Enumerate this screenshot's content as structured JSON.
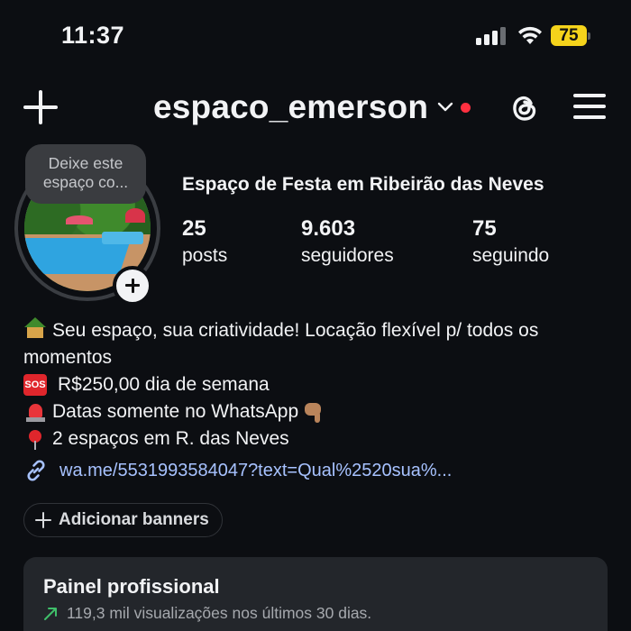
{
  "status_bar": {
    "time": "11:37",
    "battery": "75",
    "battery_color": "#f5d31b"
  },
  "header": {
    "username": "espaco_emerson",
    "icons": [
      "plus-icon",
      "chevron-down-icon",
      "threads-icon",
      "hamburger-menu-icon"
    ],
    "notification_dot_color": "#ff3040"
  },
  "profile": {
    "note": "Deixe este espaço co...",
    "full_name": "Espaço de Festa em Ribeirão das Neves",
    "stats": [
      {
        "value": "25",
        "label": "posts"
      },
      {
        "value": "9.603",
        "label": "seguidores"
      },
      {
        "value": "75",
        "label": "seguindo"
      }
    ]
  },
  "bio": {
    "lines": [
      {
        "emoji": "house-with-garden-emoji",
        "text": "Seu espaço, sua criatividade! Locação flexível p/ todos os momentos"
      },
      {
        "emoji": "sos-emoji",
        "text": "R$250,00 dia de semana"
      },
      {
        "emoji": "police-light-emoji",
        "text": "Datas somente no WhatsApp",
        "trailing_emoji": "backhand-index-pointing-down-emoji"
      },
      {
        "emoji": "round-pushpin-emoji",
        "text": "2 espaços em R. das Neves"
      }
    ],
    "link": "wa.me/5531993584047?text=Qual%2520sua%...",
    "link_color": "#a7c2ff"
  },
  "banners": {
    "label": "Adicionar banners"
  },
  "pro_panel": {
    "title": "Painel profissional",
    "subtitle": "119,3 mil visualizações nos últimos 30 dias.",
    "trend_color": "#3fbf6a"
  }
}
